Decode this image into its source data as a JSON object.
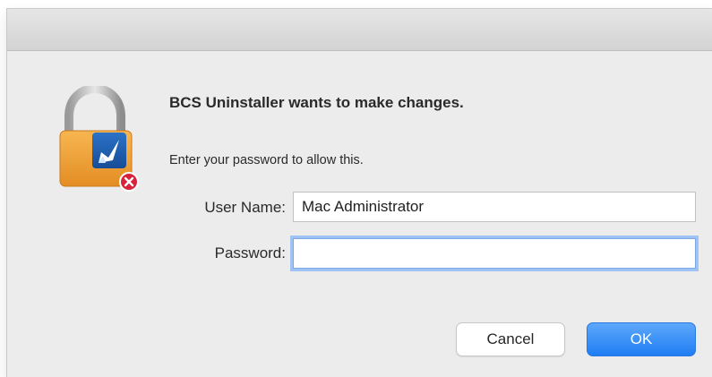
{
  "dialog": {
    "heading": "BCS Uninstaller wants to make changes.",
    "subtext": "Enter your password to allow this.",
    "icon": "padlock-with-app-badge-icon",
    "badge_icon": "error-x-icon"
  },
  "form": {
    "user_name_label": "User Name:",
    "user_name_value": "Mac Administrator",
    "password_label": "Password:",
    "password_value": ""
  },
  "buttons": {
    "cancel_label": "Cancel",
    "ok_label": "OK"
  },
  "colors": {
    "accent": "#1f7df3",
    "focus_ring": "#9fc3f4",
    "lock_gold": "#f2a23a",
    "app_blue": "#1d5fb0",
    "badge_red": "#d9213a"
  }
}
